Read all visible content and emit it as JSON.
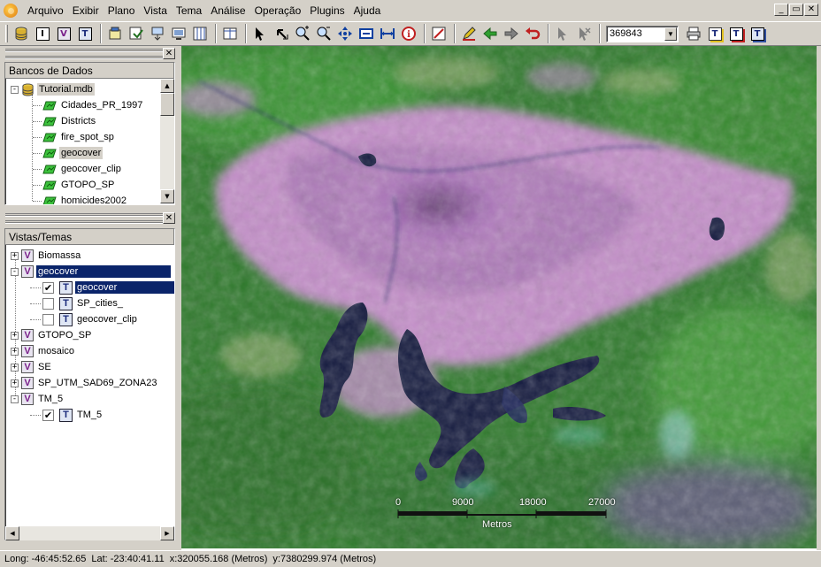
{
  "menu": {
    "items": [
      "Arquivo",
      "Exibir",
      "Plano",
      "Vista",
      "Tema",
      "Análise",
      "Operação",
      "Plugins",
      "Ajuda"
    ]
  },
  "window_controls": {
    "minimize": "_",
    "restore": "▭",
    "close": "✕"
  },
  "toolbar": {
    "scale_value": "369843"
  },
  "databases_panel": {
    "title": "Bancos de Dados",
    "root": "Tutorial.mdb",
    "layers": [
      "Cidades_PR_1997",
      "Districts",
      "fire_spot_sp",
      "geocover",
      "geocover_clip",
      "GTOPO_SP",
      "homicides2002"
    ],
    "selected": "geocover"
  },
  "views_panel": {
    "title": "Vistas/Temas",
    "items": [
      {
        "label": "Biomassa",
        "expander": "+"
      },
      {
        "label": "geocover",
        "expander": "-"
      },
      {
        "label": "geocover",
        "theme": true,
        "checked": true
      },
      {
        "label": "SP_cities_",
        "theme": true,
        "checked": false
      },
      {
        "label": "geocover_clip",
        "theme": true,
        "checked": false
      },
      {
        "label": "GTOPO_SP",
        "expander": "+"
      },
      {
        "label": "mosaico",
        "expander": "+"
      },
      {
        "label": "SE",
        "expander": "+"
      },
      {
        "label": "SP_UTM_SAD69_ZONA23",
        "expander": "+"
      },
      {
        "label": "TM_5",
        "expander": "-"
      },
      {
        "label": "TM_5",
        "theme": true,
        "checked": true
      }
    ]
  },
  "map": {
    "scale_ticks": [
      "0",
      "9000",
      "18000",
      "27000"
    ],
    "scale_unit": "Metros"
  },
  "status": {
    "long": "Long: -46:45:52.65",
    "lat": "Lat: -23:40:41.11",
    "x": "x:320055.168 (Metros)",
    "y": "y:7380299.974 (Metros)"
  },
  "colors": {
    "selection_blue": "#0a246a",
    "chrome": "#d4d0c8",
    "vegetation": "#2f7a2c",
    "urban": "#c080c8",
    "water": "#101838"
  }
}
